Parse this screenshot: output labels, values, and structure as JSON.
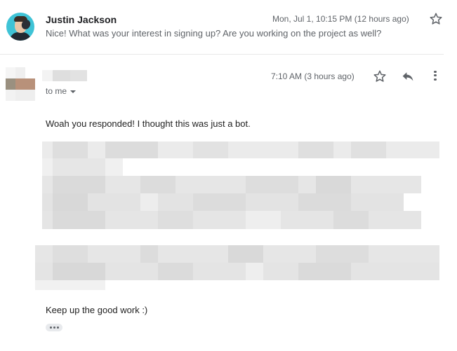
{
  "message1": {
    "sender": "Justin Jackson",
    "date": "Mon, Jul 1, 10:15 PM (12 hours ago)",
    "snippet": "Nice! What was your interest in signing up? Are you working on the project as well?",
    "avatar_color": "#3fc3d6"
  },
  "message2": {
    "recipient_label": "to me",
    "time": "7:10 AM (3 hours ago)",
    "body_line1": "Woah you responded! I thought this was just a bot.",
    "body_line2": "Keep up the good work :)",
    "redacted_sender_name": true,
    "redacted_body_paragraphs": 2
  },
  "icons": {
    "star": "star-icon",
    "reply": "reply-icon",
    "more": "more-vert-icon",
    "caret": "caret-down-icon",
    "ellipsis": "more-horiz-icon"
  },
  "colors": {
    "text_primary": "#202124",
    "text_secondary": "#5f6368",
    "divider": "#e8e8e8"
  }
}
